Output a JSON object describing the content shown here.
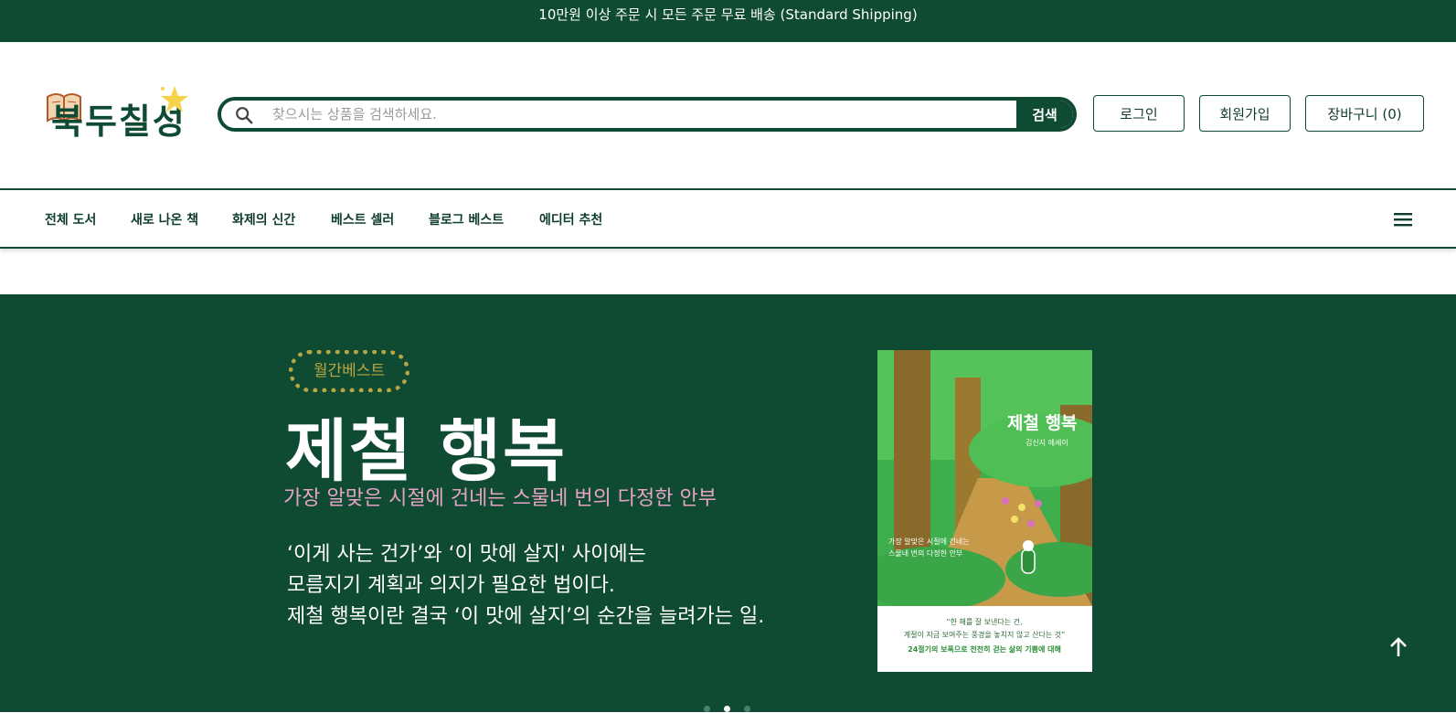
{
  "promo": {
    "text": "10만원 이상 주문 시 모든 주문 무료 배송 (Standard Shipping)"
  },
  "header": {
    "logo_text": "북두칠성",
    "search": {
      "placeholder": "찾으시는 상품을 검색하세요.",
      "button": "검색"
    },
    "login": "로그인",
    "signup": "회원가입",
    "cart": "장바구니 (0)"
  },
  "nav": {
    "items": [
      {
        "label": "전체 도서"
      },
      {
        "label": "새로 나온 책"
      },
      {
        "label": "화제의 신간"
      },
      {
        "label": "베스트 셀러"
      },
      {
        "label": "블로그 베스트"
      },
      {
        "label": "에디터 추천"
      }
    ],
    "menu_icon": "hamburger-icon"
  },
  "hero": {
    "badge": "월간베스트",
    "title": "제철 행복",
    "subtitle": "가장 알맞은 시절에 건네는 스물네 번의 다정한 안부",
    "description": [
      "‘이게 사는 건가’와 ‘이 맛에 살지' 사이에는",
      "모름지기 계획과 의지가 필요한 법이다.",
      "제철 행복이란 결국 ‘이 맛에 살지’의 순간을 늘려가는 일."
    ],
    "cover": {
      "title": "제철 행복",
      "author": "김신지 에세이",
      "tagline_1": "가장 알맞은 시절에 건네는",
      "tagline_2": "스물네 번의 다정한 안부",
      "quote_1": "“한 해를 잘 보낸다는 건,",
      "quote_2": "계절이 지금 보여주는 풍경을 놓치지 않고 산다는 것”",
      "footer": "24절기의 보폭으로 천천히 걷는 삶의 기쁨에 대해"
    },
    "slides": {
      "count": 3,
      "active": 2
    }
  },
  "colors": {
    "brand": "#0f4a33",
    "badge": "#b7a642",
    "subtitle": "#e7a3c5"
  },
  "icons": {
    "search": "search-icon",
    "to_top": "arrow-up-icon"
  }
}
